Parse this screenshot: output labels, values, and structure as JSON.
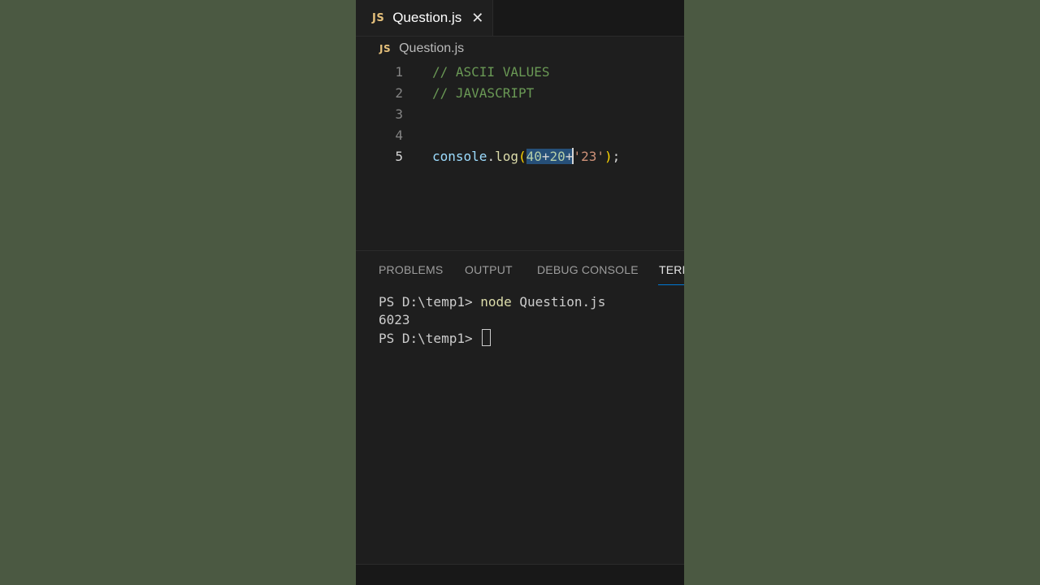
{
  "tab": {
    "badge": "JS",
    "name": "Question.js",
    "close": "✕"
  },
  "breadcrumb": {
    "badge": "JS",
    "name": "Question.js"
  },
  "editor": {
    "lines": [
      {
        "num": "1",
        "text": "// ASCII VALUES"
      },
      {
        "num": "2",
        "text": "// JAVASCRIPT"
      },
      {
        "num": "3",
        "text": ""
      },
      {
        "num": "4",
        "text": ""
      },
      {
        "num": "5",
        "ident": "console",
        "dot": ".",
        "fn": "log",
        "open": "(",
        "sel1": "40",
        "plus1": "+",
        "sel2": "20",
        "plus2": "+",
        "str": "'23'",
        "close": ")",
        "semi": ";"
      }
    ]
  },
  "panel": {
    "tabs": [
      "PROBLEMS",
      "OUTPUT",
      "DEBUG CONSOLE",
      "TERMINAL"
    ],
    "active_tab": "TERMINAL"
  },
  "terminal": {
    "prompt1": "PS D:\\temp1> ",
    "cmd": "node",
    "arg": " Question.js",
    "output": "6023",
    "prompt2": "PS D:\\temp1> "
  },
  "colors": {
    "accent": "#0078d4",
    "js_badge": "#e5c07b",
    "selection": "#264f78"
  }
}
